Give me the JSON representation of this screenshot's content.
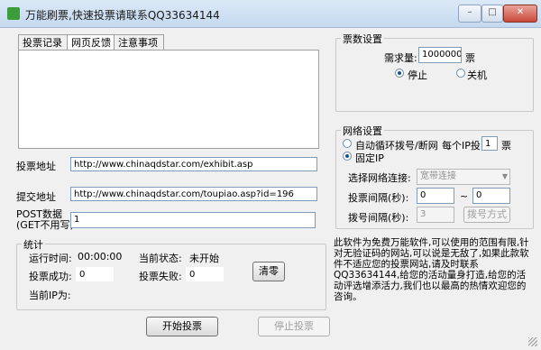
{
  "window": {
    "title": "万能刷票,快速投票请联系QQ33634144",
    "minimize": "–",
    "maximize": "□",
    "close": "✕"
  },
  "tabs": [
    "投票记录",
    "网页反馈",
    "注意事项"
  ],
  "left": {
    "vote_url_label": "投票地址",
    "vote_url_value": "http://www.chinaqdstar.com/exhibit.asp",
    "submit_url_label": "提交地址",
    "submit_url_value": "http://www.chinaqdstar.com/toupiao.asp?id=196",
    "post_label_1": "POST数据",
    "post_label_2": "(GET不用写)",
    "post_value": "1"
  },
  "stats": {
    "title": "统计",
    "run_time_label": "运行时间:",
    "run_time_value": "00:00:00",
    "status_label": "当前状态:",
    "status_value": "未开始",
    "success_label": "投票成功:",
    "success_value": "0",
    "fail_label": "投票失败:",
    "fail_value": "0",
    "clear_button": "清零",
    "ip_label": "当前IP为:"
  },
  "buttons": {
    "start": "开始投票",
    "stop": "停止投票"
  },
  "vote_settings": {
    "title": "票数设置",
    "need_label": "需求量:",
    "need_value": "1000000",
    "unit": "票",
    "stop_label": "停止",
    "shutdown_label": "关机"
  },
  "network": {
    "title": "网络设置",
    "auto_label": "自动循环拨号/断网",
    "per_ip_label": "每个IP投",
    "per_ip_value": "1",
    "per_ip_unit": "票",
    "fixed_label": "固定IP",
    "choose_label": "选择网络连接:",
    "choose_value": "宽带连接",
    "vote_interval_label": "投票间隔(秒):",
    "interval_from": "0",
    "tilde": "~",
    "interval_to": "0",
    "dial_interval_label": "拨号间隔(秒):",
    "dial_interval_value": "3",
    "dial_mode_button": "拨号方式"
  },
  "info_text": "此软件为免费万能软件,可以使用的范围有限,针对无验证码的网站,可以说是无敌了,如果此款软件不适应您的投票网站,请及时联系QQ33634144,给您的活动量身打造,给您的活动评选增添活力,我们也以最高的热情欢迎您的咨询。"
}
